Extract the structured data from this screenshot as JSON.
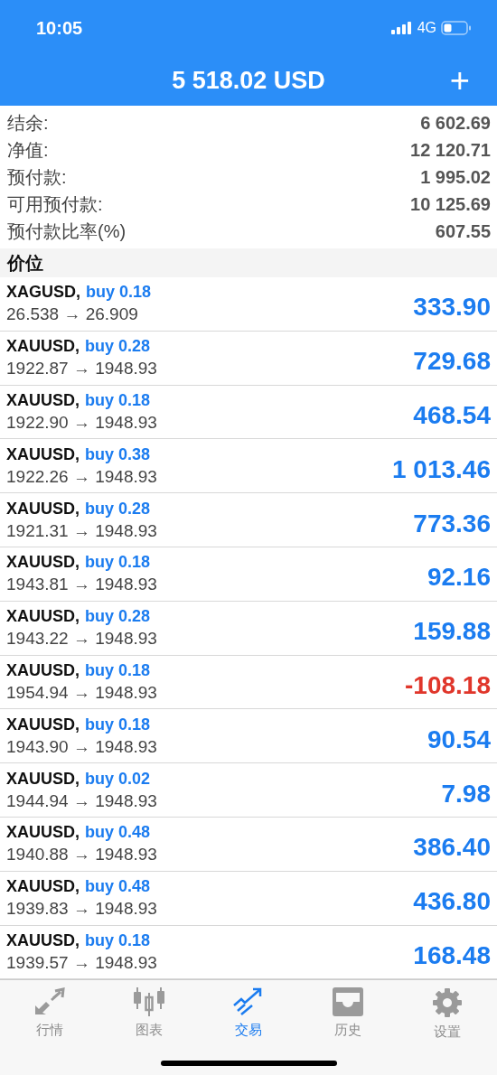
{
  "status_bar": {
    "time": "10:05",
    "network": "4G"
  },
  "header": {
    "title": "5 518.02 USD",
    "action": "+"
  },
  "summary": [
    {
      "label": "结余:",
      "value": "6 602.69"
    },
    {
      "label": "净值:",
      "value": "12 120.71"
    },
    {
      "label": "预付款:",
      "value": "1 995.02"
    },
    {
      "label": "可用预付款:",
      "value": "10 125.69"
    },
    {
      "label": "预付款比率(%)",
      "value": "607.55"
    }
  ],
  "section": "价位",
  "trades": [
    {
      "symbol": "XAGUSD,",
      "side": "buy 0.18",
      "prices": "26.538 → 26.909",
      "profit": "333.90",
      "color": "#1b7cf0"
    },
    {
      "symbol": "XAUUSD,",
      "side": "buy 0.28",
      "prices": "1922.87 → 1948.93",
      "profit": "729.68",
      "color": "#1b7cf0"
    },
    {
      "symbol": "XAUUSD,",
      "side": "buy 0.18",
      "prices": "1922.90 → 1948.93",
      "profit": "468.54",
      "color": "#1b7cf0"
    },
    {
      "symbol": "XAUUSD,",
      "side": "buy 0.38",
      "prices": "1922.26 → 1948.93",
      "profit": "1 013.46",
      "color": "#1b7cf0"
    },
    {
      "symbol": "XAUUSD,",
      "side": "buy 0.28",
      "prices": "1921.31 → 1948.93",
      "profit": "773.36",
      "color": "#1b7cf0"
    },
    {
      "symbol": "XAUUSD,",
      "side": "buy 0.18",
      "prices": "1943.81 → 1948.93",
      "profit": "92.16",
      "color": "#1b7cf0"
    },
    {
      "symbol": "XAUUSD,",
      "side": "buy 0.28",
      "prices": "1943.22 → 1948.93",
      "profit": "159.88",
      "color": "#1b7cf0"
    },
    {
      "symbol": "XAUUSD,",
      "side": "buy 0.18",
      "prices": "1954.94 → 1948.93",
      "profit": "-108.18",
      "color": "#e0362b"
    },
    {
      "symbol": "XAUUSD,",
      "side": "buy 0.18",
      "prices": "1943.90 → 1948.93",
      "profit": "90.54",
      "color": "#1b7cf0"
    },
    {
      "symbol": "XAUUSD,",
      "side": "buy 0.02",
      "prices": "1944.94 → 1948.93",
      "profit": "7.98",
      "color": "#1b7cf0"
    },
    {
      "symbol": "XAUUSD,",
      "side": "buy 0.48",
      "prices": "1940.88 → 1948.93",
      "profit": "386.40",
      "color": "#1b7cf0"
    },
    {
      "symbol": "XAUUSD,",
      "side": "buy 0.48",
      "prices": "1939.83 → 1948.93",
      "profit": "436.80",
      "color": "#1b7cf0"
    },
    {
      "symbol": "XAUUSD,",
      "side": "buy 0.18",
      "prices": "1939.57 → 1948.93",
      "profit": "168.48",
      "color": "#1b7cf0"
    }
  ],
  "tabs": [
    {
      "label": "行情",
      "kind": "quotes",
      "selected": false
    },
    {
      "label": "图表",
      "kind": "chart",
      "selected": false
    },
    {
      "label": "交易",
      "kind": "trade",
      "selected": true
    },
    {
      "label": "历史",
      "kind": "history",
      "selected": false
    },
    {
      "label": "设置",
      "kind": "settings",
      "selected": false
    }
  ]
}
